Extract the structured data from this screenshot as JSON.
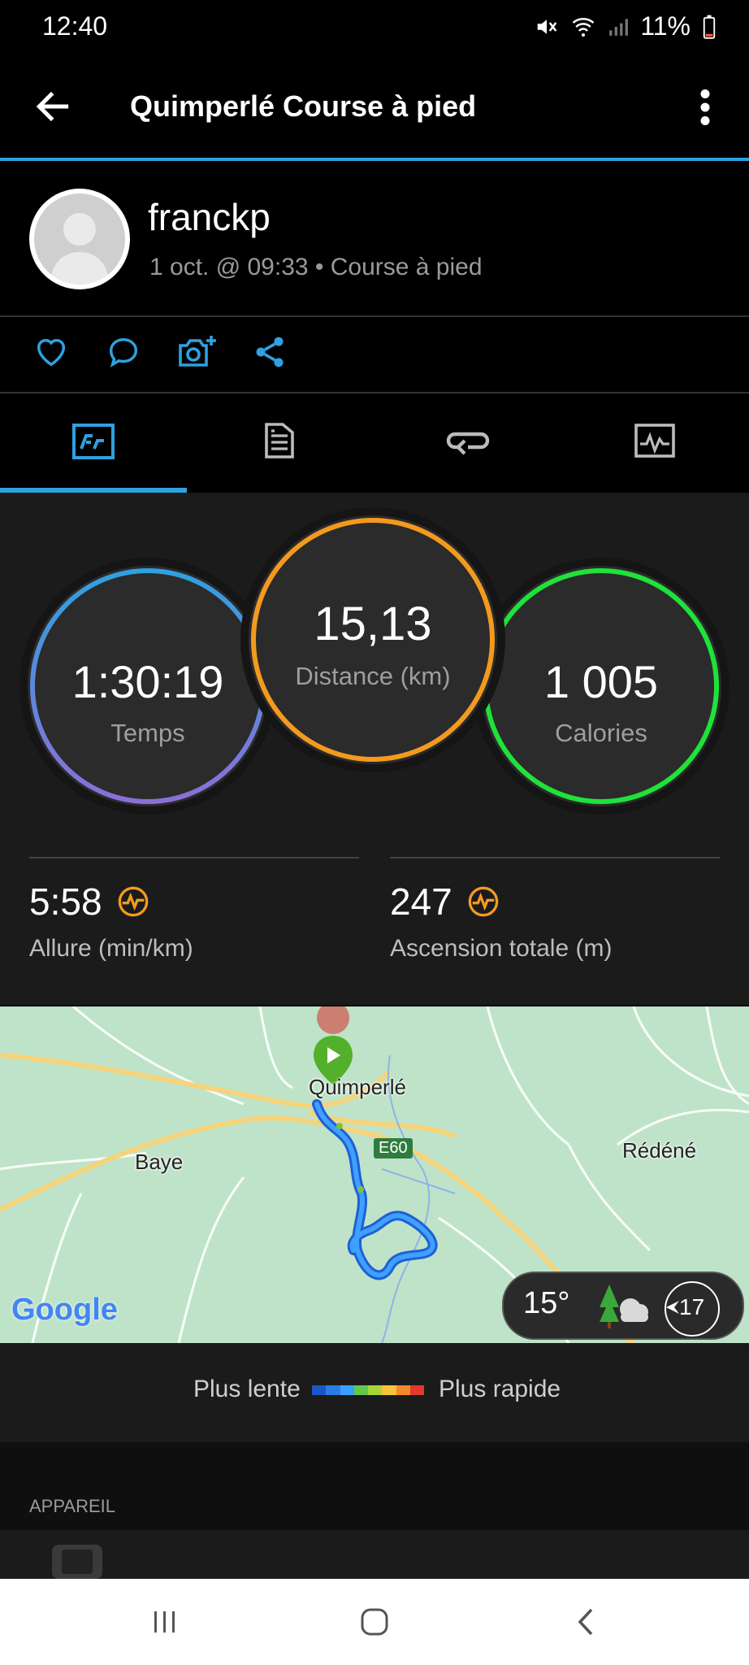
{
  "status": {
    "time": "12:40",
    "battery": "11%"
  },
  "header": {
    "title": "Quimperlé Course à pied"
  },
  "profile": {
    "username": "franckp",
    "meta": "1 oct. @ 09:33 • Course à pied"
  },
  "stats": {
    "time": {
      "value": "1:30:19",
      "label": "Temps"
    },
    "distance": {
      "value": "15,13",
      "label": "Distance (km)"
    },
    "calories": {
      "value": "1 005",
      "label": "Calories"
    },
    "pace": {
      "value": "5:58",
      "label": "Allure (min/km)"
    },
    "ascent": {
      "value": "247",
      "label": "Ascension totale (m)"
    }
  },
  "map": {
    "labels": {
      "town": "Quimperlé",
      "baye": "Baye",
      "redene": "Rédéné",
      "road": "E60"
    },
    "google": "Google",
    "weather": {
      "temp": "15°",
      "wind": "17"
    }
  },
  "legend": {
    "slow": "Plus lente",
    "fast": "Plus rapide"
  },
  "section": {
    "device": "APPAREIL"
  },
  "colors": {
    "accent": "#2fa1e0",
    "distance_ring": "#f39a1e",
    "calories_ring": "#1fe23a",
    "time_ring_top": "#2fa1e0",
    "time_ring_bottom": "#8a6fd8"
  }
}
